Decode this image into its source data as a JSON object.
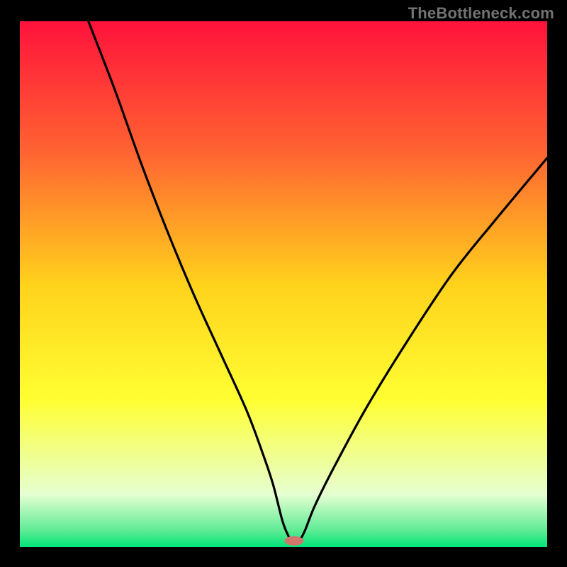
{
  "watermark": {
    "text": "TheBottleneck.com"
  },
  "chart_data": {
    "type": "line",
    "title": "",
    "xlabel": "",
    "ylabel": "",
    "xlim": [
      0,
      100
    ],
    "ylim": [
      0,
      100
    ],
    "grid": false,
    "legend": false,
    "gradient_stops": [
      {
        "offset": 0.0,
        "color": "#FF123B"
      },
      {
        "offset": 0.25,
        "color": "#FF6432"
      },
      {
        "offset": 0.5,
        "color": "#FFD21C"
      },
      {
        "offset": 0.72,
        "color": "#FFFF32"
      },
      {
        "offset": 0.9,
        "color": "#E6FFD2"
      },
      {
        "offset": 0.97,
        "color": "#5AEB92"
      },
      {
        "offset": 1.0,
        "color": "#00E57A"
      }
    ],
    "series": [
      {
        "name": "bottleneck-curve",
        "x": [
          13,
          18,
          23,
          28,
          33,
          38,
          43,
          46,
          48,
          49.8,
          51,
          51.8,
          52.0,
          52.8,
          54,
          56,
          60,
          66,
          74,
          82,
          90,
          100
        ],
        "y": [
          100,
          87,
          73,
          60,
          48,
          37,
          26,
          18,
          12,
          5.0,
          2.0,
          1.0,
          1.0,
          1.0,
          3.0,
          8.0,
          16,
          27,
          40,
          52,
          62,
          74
        ]
      }
    ],
    "marker": {
      "name": "optimal-point",
      "x": 52.0,
      "y": 1.2,
      "color": "#D3766B",
      "rx": 1.8,
      "ry": 0.9
    }
  }
}
